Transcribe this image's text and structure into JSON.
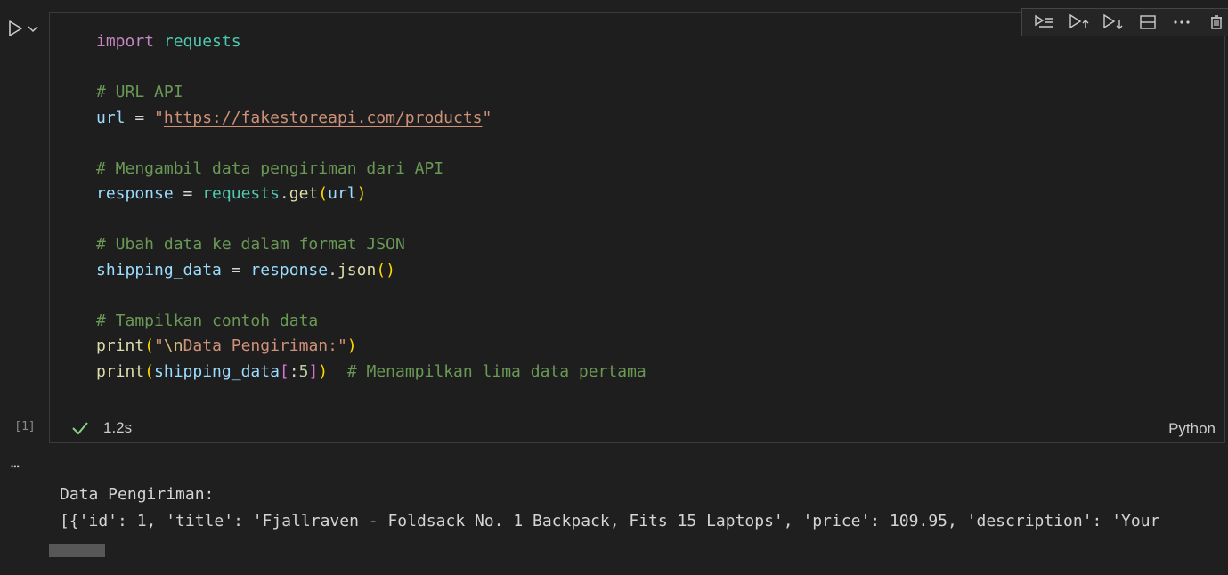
{
  "cell": {
    "execution_count": "[1]",
    "duration": "1.2s",
    "language": "Python",
    "code": {
      "line1": {
        "kw": "import",
        "mod": "requests"
      },
      "comment1": "# URL API",
      "line2": {
        "var": "url",
        "op": " = ",
        "q1": "\"",
        "url": "https://fakestoreapi.com/products",
        "q2": "\""
      },
      "comment2": "# Mengambil data pengiriman dari API",
      "line3": {
        "var": "response",
        "op": " = ",
        "mod": "requests",
        "dot": ".",
        "fn": "get",
        "open": "(",
        "arg": "url",
        "close": ")"
      },
      "comment3": "# Ubah data ke dalam format JSON",
      "line4": {
        "var": "shipping_data",
        "op": " = ",
        "obj": "response",
        "dot": ".",
        "fn": "json",
        "parens": "()"
      },
      "comment4": "# Tampilkan contoh data",
      "line5": {
        "fn": "print",
        "open": "(",
        "q1": "\"",
        "esc": "\\n",
        "str": "Data Pengiriman:",
        "q2": "\"",
        "close": ")"
      },
      "line6": {
        "fn": "print",
        "open": "(",
        "var": "shipping_data",
        "lb": "[",
        "colon": ":",
        "num": "5",
        "rb": "]",
        "close": ")",
        "gap": "  ",
        "comment": "# Menampilkan lima data pertama"
      }
    }
  },
  "output": {
    "line1": "Data Pengiriman:",
    "line2": "[{'id': 1, 'title': 'Fjallraven - Foldsack No. 1 Backpack, Fits 15 Laptops', 'price': 109.95, 'description': 'Your"
  },
  "toolbar": {
    "icons": [
      "run-by-line-icon",
      "execute-above-icon",
      "execute-below-icon",
      "split-cell-icon",
      "more-icon",
      "delete-icon"
    ]
  },
  "colors": {
    "background": "#1f1f1f",
    "keyword": "#c586c0",
    "string": "#ce9178",
    "comment": "#6a9955",
    "function": "#dcdcaa",
    "variable": "#9cdcfe",
    "success": "#89d185"
  }
}
